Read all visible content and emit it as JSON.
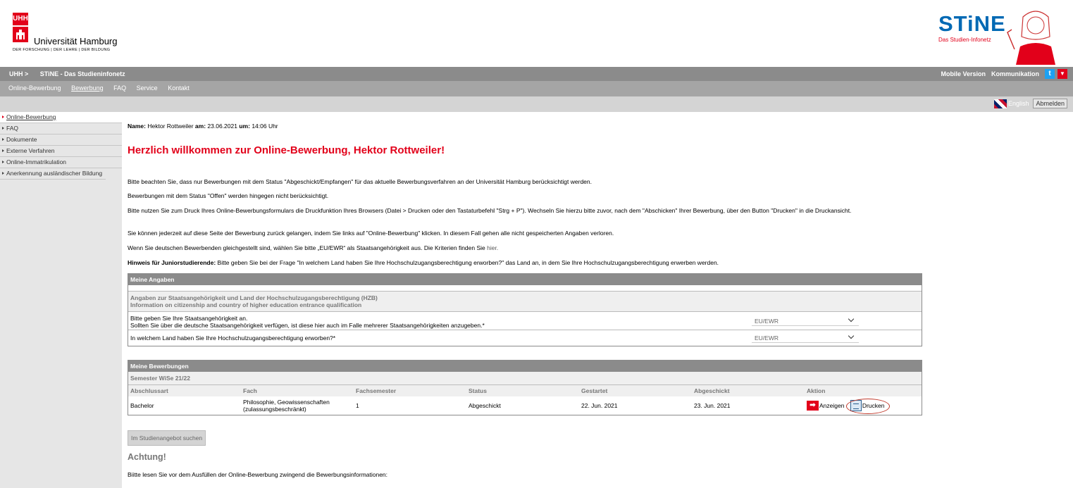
{
  "header": {
    "uhh_badge": "UHH",
    "university": "Universität Hamburg",
    "university_sub": "DER FORSCHUNG | DER LEHRE | DER BILDUNG",
    "stine_title": "STiNE",
    "stine_sub": "Das Studien-Infonetz"
  },
  "topbar": {
    "crumb_uhh": "UHH >",
    "crumb_stine": "STiNE - Das Studieninfonetz",
    "mobile": "Mobile Version",
    "kommunikation": "Kommunikation"
  },
  "nav": {
    "items": [
      "Online-Bewerbung",
      "Bewerbung",
      "FAQ",
      "Service",
      "Kontakt"
    ]
  },
  "langbar": {
    "english": "English",
    "logout": "Abmelden"
  },
  "sidebar": {
    "items": [
      "Online-Bewerbung",
      "FAQ",
      "Dokumente",
      "Externe Verfahren",
      "Online-Immatrikulation",
      "Anerkennung ausländischer Bildung"
    ]
  },
  "main": {
    "name_label": "Name:",
    "name_value": "Hektor Rottweiler",
    "am_label": "am:",
    "date_value": "23.06.2021",
    "um_label": "um:",
    "time_value": "14:06 Uhr",
    "welcome": "Herzlich willkommen zur Online-Bewerbung, Hektor Rottweiler!",
    "p1": "Bitte beachten Sie, dass nur Bewerbungen mit dem Status \"Abgeschickt/Empfangen\" für das aktuelle Bewerbungsverfahren an der Universität Hamburg berücksichtigt werden.",
    "p2": "Bewerbungen mit dem Status \"Offen\" werden hingegen nicht berücksichtigt.",
    "p3": "Bitte nutzen Sie zum Druck Ihres Online-Bewerbungsformulars die Druckfunktion Ihres Browsers (Datei > Drucken oder den Tastaturbefehl \"Strg + P\"). Wechseln Sie hierzu bitte zuvor, nach dem \"Abschicken\" Ihrer Bewerbung, über den Button \"Drucken\" in die Druckansicht.",
    "p4": "Sie können jederzeit auf diese Seite der Bewerbung zurück gelangen, indem Sie links auf \"Online-Bewerbung\" klicken. In diesem Fall gehen alle nicht gespeicherten Angaben verloren.",
    "p5": "Wenn Sie deutschen Bewerbenden gleichgestellt sind, wählen Sie bitte „EU/EWR“ als Staatsangehörigkeit aus. Die Kriterien finden Sie",
    "p5_link": "hier.",
    "p6_bold": "Hinweis für Juniorstudierende:",
    "p6": "Bitte geben Sie bei der Frage \"In welchem Land haben Sie Ihre Hochschulzugangsberechtigung erworben?\" das Land an, in dem Sie Ihre Hochschulzugangsberechtigung erwerben werden."
  },
  "angaben": {
    "title": "Meine Angaben",
    "section_line1": "Angaben zur Staatsangehörigkeit und Land der Hochschulzugangsberechtigung (HZB)",
    "section_line2": "Information on citizenship and country of higher education entrance qualification",
    "q1_line1": "Bitte geben Sie Ihre Staatsangehörigkeit an.",
    "q1_line2": "Sollten Sie über die deutsche Staatsangehörigkeit verfügen, ist diese hier auch im Falle mehrerer Staatsangehörigkeiten anzugeben.*",
    "q1_value": "EU/EWR",
    "q2": "In welchem Land haben Sie Ihre Hochschulzugangsberechtigung erworben?*",
    "q2_value": "EU/EWR"
  },
  "bewerbungen": {
    "title": "Meine Bewerbungen",
    "semester": "Semester WiSe 21/22",
    "columns": [
      "Abschlussart",
      "Fach",
      "Fachsemester",
      "Status",
      "Gestartet",
      "Abgeschickt",
      "Aktion"
    ],
    "row": {
      "abschlussart": "Bachelor",
      "fach_line1": "Philosophie, Geowissenschaften",
      "fach_line2": "(zulassungsbeschränkt)",
      "fachsemester": "1",
      "status": "Abgeschickt",
      "gestartet": "22. Jun. 2021",
      "abgeschickt": "23. Jun. 2021",
      "anzeigen": "Anzeigen",
      "drucken": "Drucken"
    }
  },
  "footer": {
    "search_button": "Im Studienangebot suchen",
    "achtung": "Achtung!",
    "achtung_text": "Biitte lesen Sie vor dem Ausfüllen der Online-Bewerbung zwingend die Bewerbungsinformationen:"
  }
}
